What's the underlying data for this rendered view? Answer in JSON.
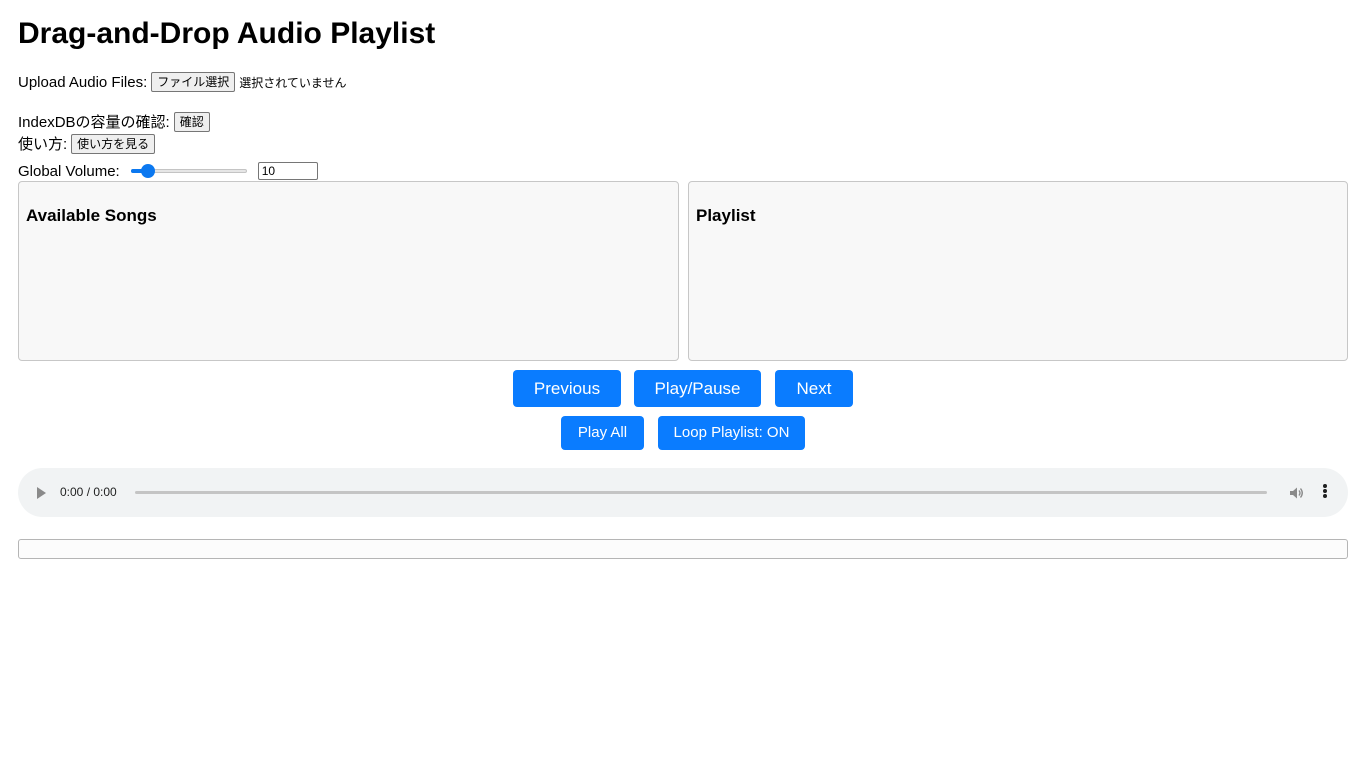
{
  "page": {
    "title": "Drag-and-Drop Audio Playlist"
  },
  "upload": {
    "label": "Upload Audio Files:",
    "button_label": "ファイル選択",
    "status": "選択されていません"
  },
  "indexdb": {
    "label": "IndexDBの容量の確認:",
    "button_label": "確認"
  },
  "howto": {
    "label": "使い方:",
    "button_label": "使い方を見る"
  },
  "volume": {
    "label": "Global Volume:",
    "value": "10",
    "level_fraction": 0.1
  },
  "panels": {
    "available_title": "Available Songs",
    "playlist_title": "Playlist"
  },
  "controls": {
    "previous": "Previous",
    "play_pause": "Play/Pause",
    "next": "Next",
    "play_all": "Play All",
    "loop": "Loop Playlist: ON"
  },
  "audio_player": {
    "time": "0:00 / 0:00"
  },
  "colors": {
    "accent": "#0a7cff"
  }
}
